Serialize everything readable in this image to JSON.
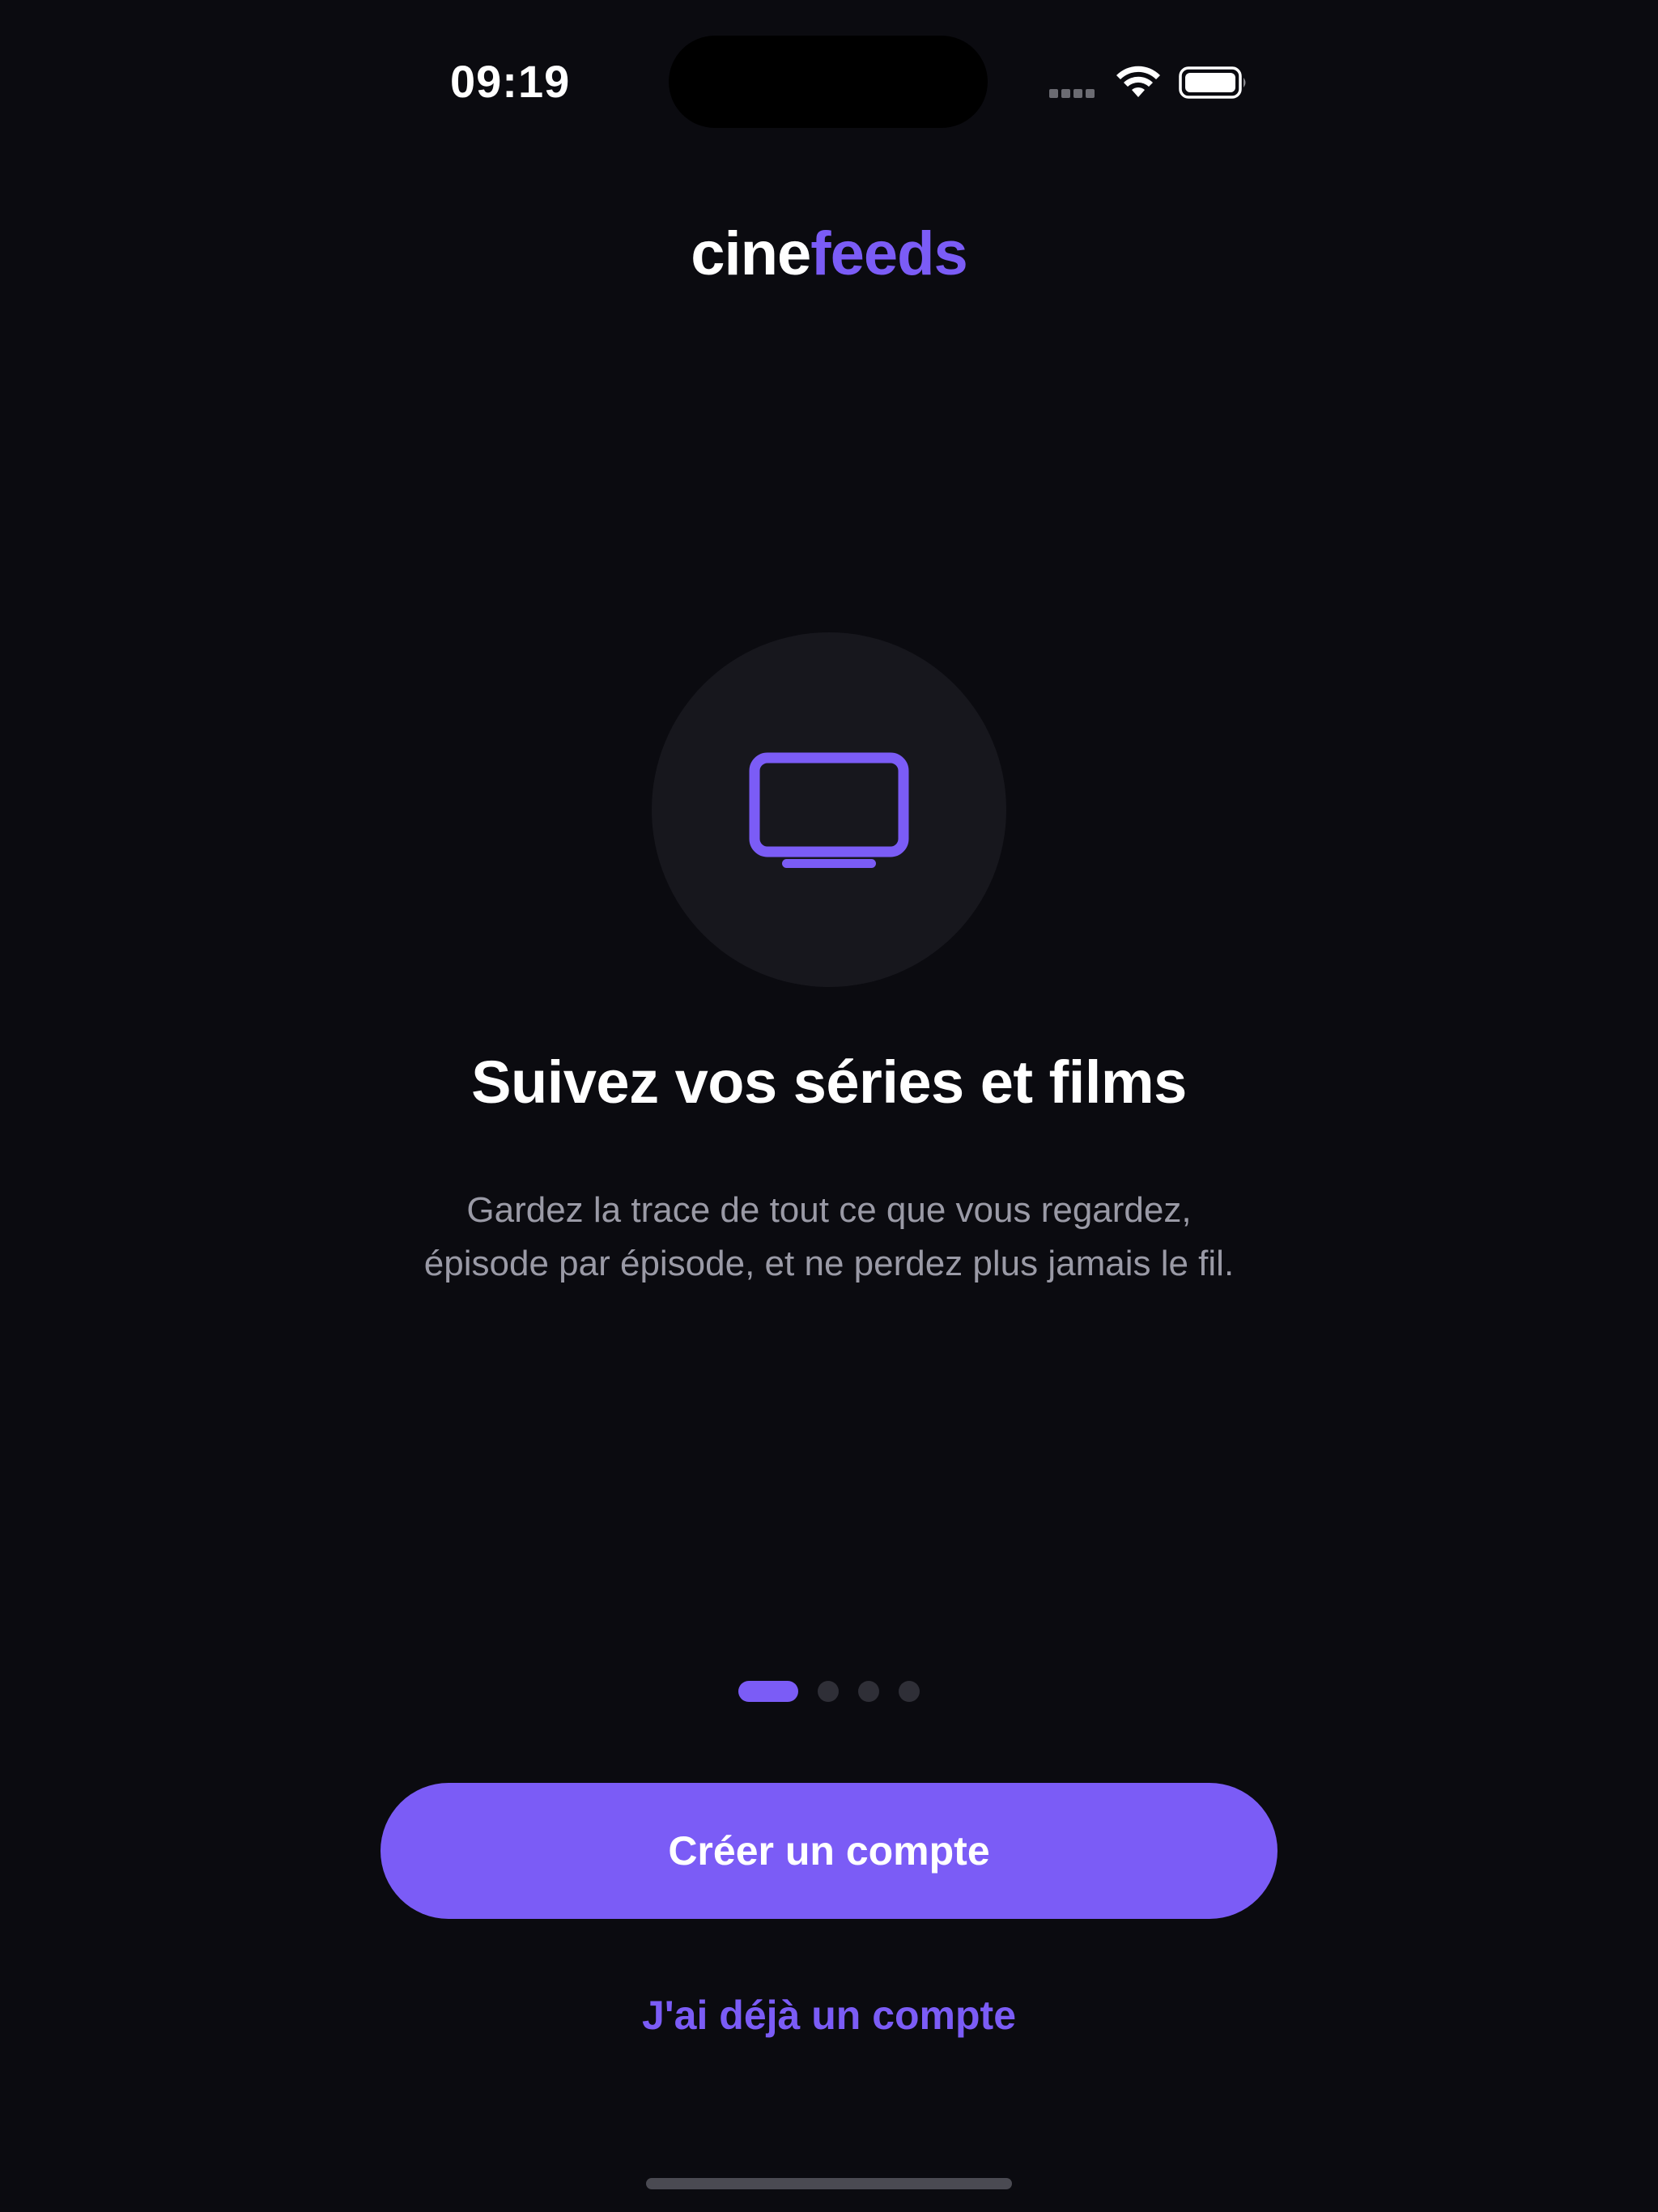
{
  "status_bar": {
    "time": "09:19",
    "icons": [
      "cellular-signal-icon",
      "wifi-icon",
      "battery-icon"
    ]
  },
  "logo": {
    "part1": "cine",
    "part2": "feeds"
  },
  "onboarding": {
    "illustration_icon": "tv-icon",
    "title": "Suivez vos séries et films",
    "description": "Gardez la trace de tout ce que vous regardez, épisode par épisode, et ne perdez plus jamais le fil.",
    "page_count": 4,
    "current_page": 1
  },
  "actions": {
    "primary_label": "Créer un compte",
    "secondary_label": "J'ai déjà un compte"
  },
  "colors": {
    "background": "#0b0b10",
    "accent": "#7b5cf6",
    "circle": "#17171d",
    "muted_text": "#9a9aa6"
  }
}
